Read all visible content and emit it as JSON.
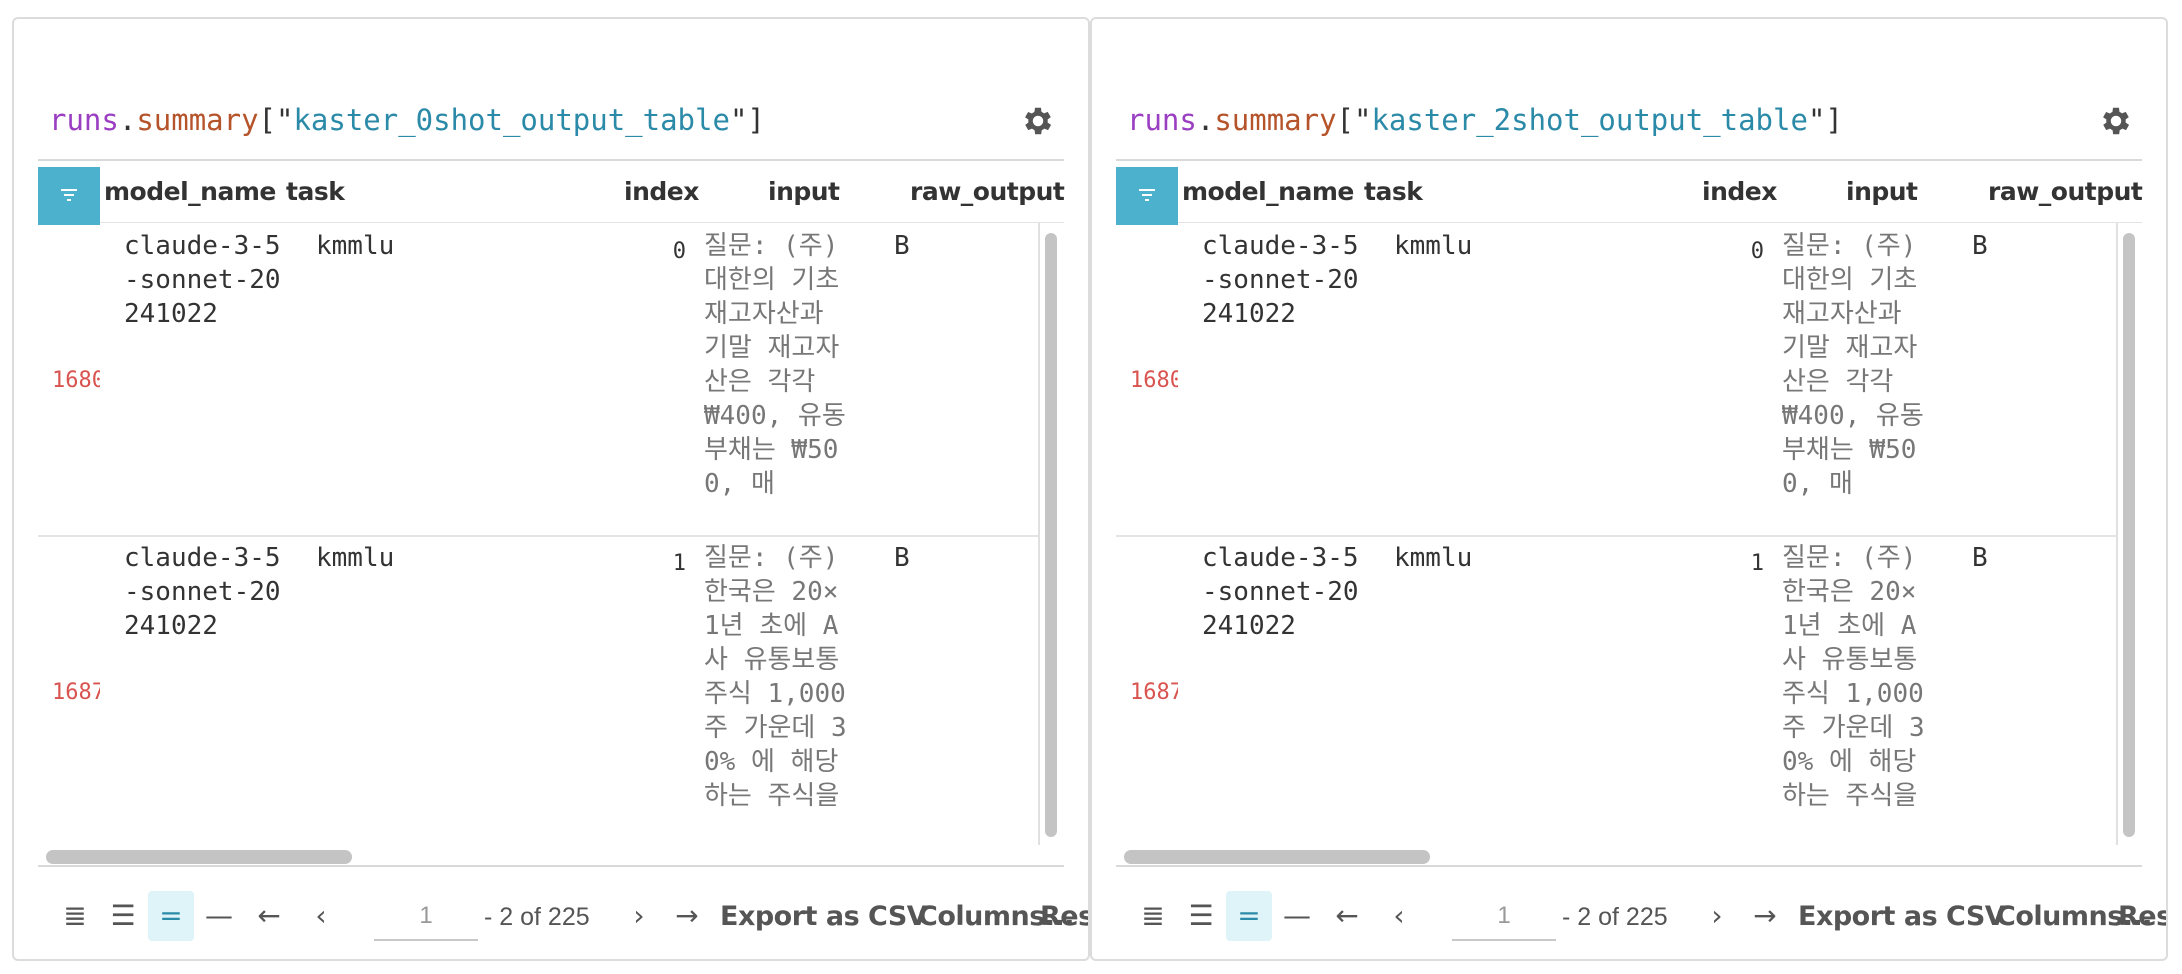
{
  "panels": [
    {
      "expr": {
        "prefix": "runs",
        "dot": ".",
        "accessor": "summary",
        "open": "[\"",
        "key": "kaster_0shot_output_table",
        "close": "\"]"
      },
      "columns": [
        "model_name",
        "task",
        "index",
        "input",
        "raw_output"
      ],
      "rows": [
        {
          "row_id": "1680",
          "model_name": "claude-3-5-sonnet-20241022",
          "task": "kmmlu",
          "index": "0",
          "input": "질문: (주) 대한의 기초재고자산과 기말 재고자산은 각각 ₩400, 유동부채는 ₩500, 매",
          "raw_output": "B"
        },
        {
          "row_id": "1687",
          "model_name": "claude-3-5-sonnet-20241022",
          "task": "kmmlu",
          "index": "1",
          "input": "질문: (주) 한국은 20×1년 초에 A사 유통보통 주식 1,000주 가운데 30% 에 해당하는 주식을",
          "raw_output": "B"
        }
      ],
      "pagination": {
        "page": "1",
        "of_text": "- 2 of 225"
      },
      "footer": {
        "export": "Export as CSV",
        "columns": "Columns...",
        "reset": "Res"
      }
    },
    {
      "expr": {
        "prefix": "runs",
        "dot": ".",
        "accessor": "summary",
        "open": "[\"",
        "key": "kaster_2shot_output_table",
        "close": "\"]"
      },
      "columns": [
        "model_name",
        "task",
        "index",
        "input",
        "raw_output"
      ],
      "rows": [
        {
          "row_id": "1680",
          "model_name": "claude-3-5-sonnet-20241022",
          "task": "kmmlu",
          "index": "0",
          "input": "질문: (주) 대한의 기초재고자산과 기말 재고자산은 각각 ₩400, 유동부채는 ₩500, 매",
          "raw_output": "B"
        },
        {
          "row_id": "1687",
          "model_name": "claude-3-5-sonnet-20241022",
          "task": "kmmlu",
          "index": "1",
          "input": "질문: (주) 한국은 20×1년 초에 A사 유통보통 주식 1,000주 가운데 30% 에 해당하는 주식을",
          "raw_output": "B"
        }
      ],
      "pagination": {
        "page": "1",
        "of_text": "- 2 of 225"
      },
      "footer": {
        "export": "Export as CSV",
        "columns": "Columns...",
        "reset": "Res"
      }
    }
  ],
  "icons": {
    "settings": "gear-icon",
    "filter": "filter-icon"
  },
  "colors": {
    "accent": "#4bb1cd",
    "row_id": "#d9534f",
    "keyword": "#9b3fc2",
    "string": "#2b8aa8"
  }
}
